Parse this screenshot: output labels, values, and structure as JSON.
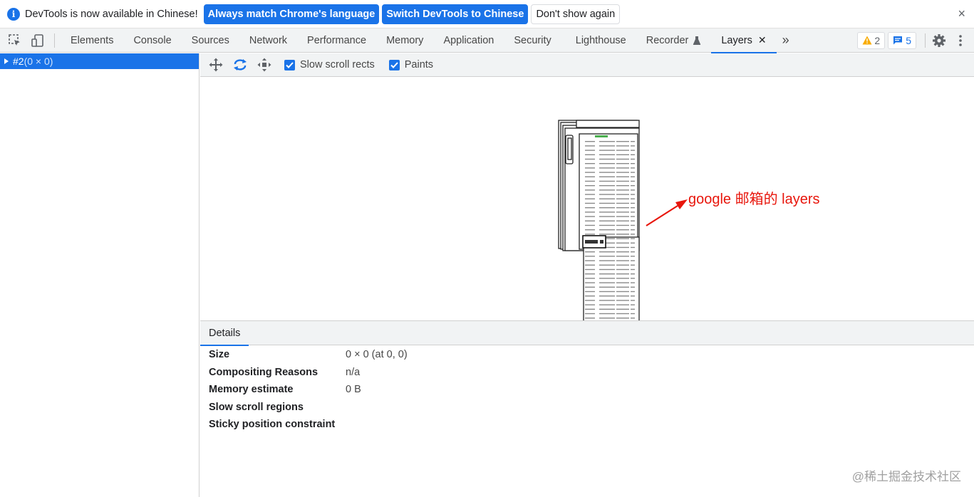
{
  "infobar": {
    "icon": "info-icon",
    "message": "DevTools is now available in Chinese!",
    "btn_match": "Always match Chrome's language",
    "btn_switch": "Switch DevTools to Chinese",
    "btn_dont_show": "Don't show again",
    "close": "×"
  },
  "tabs": {
    "items": [
      "Elements",
      "Console",
      "Sources",
      "Network",
      "Performance",
      "Memory",
      "Application",
      "Security",
      "Lighthouse",
      "Recorder",
      "Layers"
    ],
    "active": "Layers",
    "more": "»"
  },
  "status": {
    "warnings": "2",
    "messages": "5"
  },
  "layers_tree": {
    "selected": "#2",
    "selected_size": "(0 × 0)"
  },
  "layers_toolbar": {
    "slow_scroll_rects": "Slow scroll rects",
    "paints": "Paints"
  },
  "annotation": "google 邮箱的 layers",
  "details": {
    "tab": "Details",
    "rows": [
      {
        "key": "Size",
        "value": "0 × 0 (at 0, 0)"
      },
      {
        "key": "Compositing Reasons",
        "value": "n/a"
      },
      {
        "key": "Memory estimate",
        "value": "0 B"
      },
      {
        "key": "Slow scroll regions",
        "value": ""
      },
      {
        "key": "Sticky position constraint",
        "value": ""
      }
    ]
  },
  "watermark": "@稀土掘金技术社区",
  "colors": {
    "accent": "#1a73e8",
    "annotation": "#e8160c",
    "toolbar_bg": "#f1f3f4"
  }
}
